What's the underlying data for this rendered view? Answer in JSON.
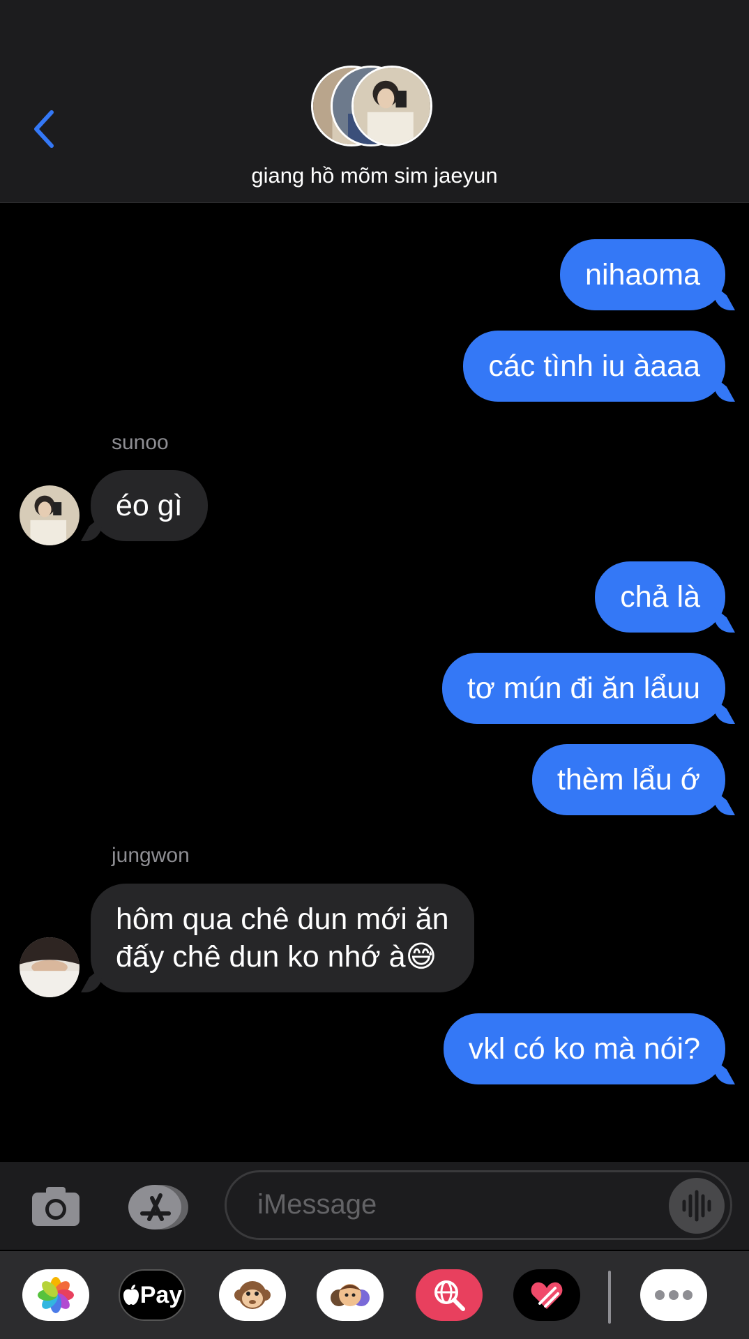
{
  "header": {
    "back_icon": "chevron-left-icon",
    "group_name": "giang hồ mõm sim jaeyun",
    "accent_color": "#3478f6"
  },
  "messages": [
    {
      "type": "outgoing",
      "text": "nihaoma"
    },
    {
      "type": "outgoing",
      "text": "các tình iu àaaa"
    },
    {
      "type": "incoming",
      "sender": "sunoo",
      "text": "éo gì"
    },
    {
      "type": "outgoing",
      "text": "chả là"
    },
    {
      "type": "outgoing",
      "text": "tơ mún đi ăn lẩuu"
    },
    {
      "type": "outgoing",
      "text": "thèm lẩu ớ"
    },
    {
      "type": "incoming",
      "sender": "jungwon",
      "line1": "hôm qua chê dun mới ăn",
      "line2": "đấy chê dun ko nhớ à😅"
    },
    {
      "type": "outgoing",
      "text": "vkl có ko mà nói?"
    }
  ],
  "input": {
    "placeholder": "iMessage",
    "camera_icon": "camera-icon",
    "appstore_icon": "app-store-icon",
    "voice_icon": "waveform-icon"
  },
  "apps": {
    "applepay_label": "Pay",
    "items": [
      "photos-icon",
      "apple-pay-icon",
      "animoji-monkey-icon",
      "memoji-icon",
      "web-search-icon",
      "digital-touch-icon",
      "more-icon"
    ]
  },
  "colors": {
    "outgoing_bubble": "#3478f6",
    "incoming_bubble": "#262628",
    "background": "#000000"
  }
}
